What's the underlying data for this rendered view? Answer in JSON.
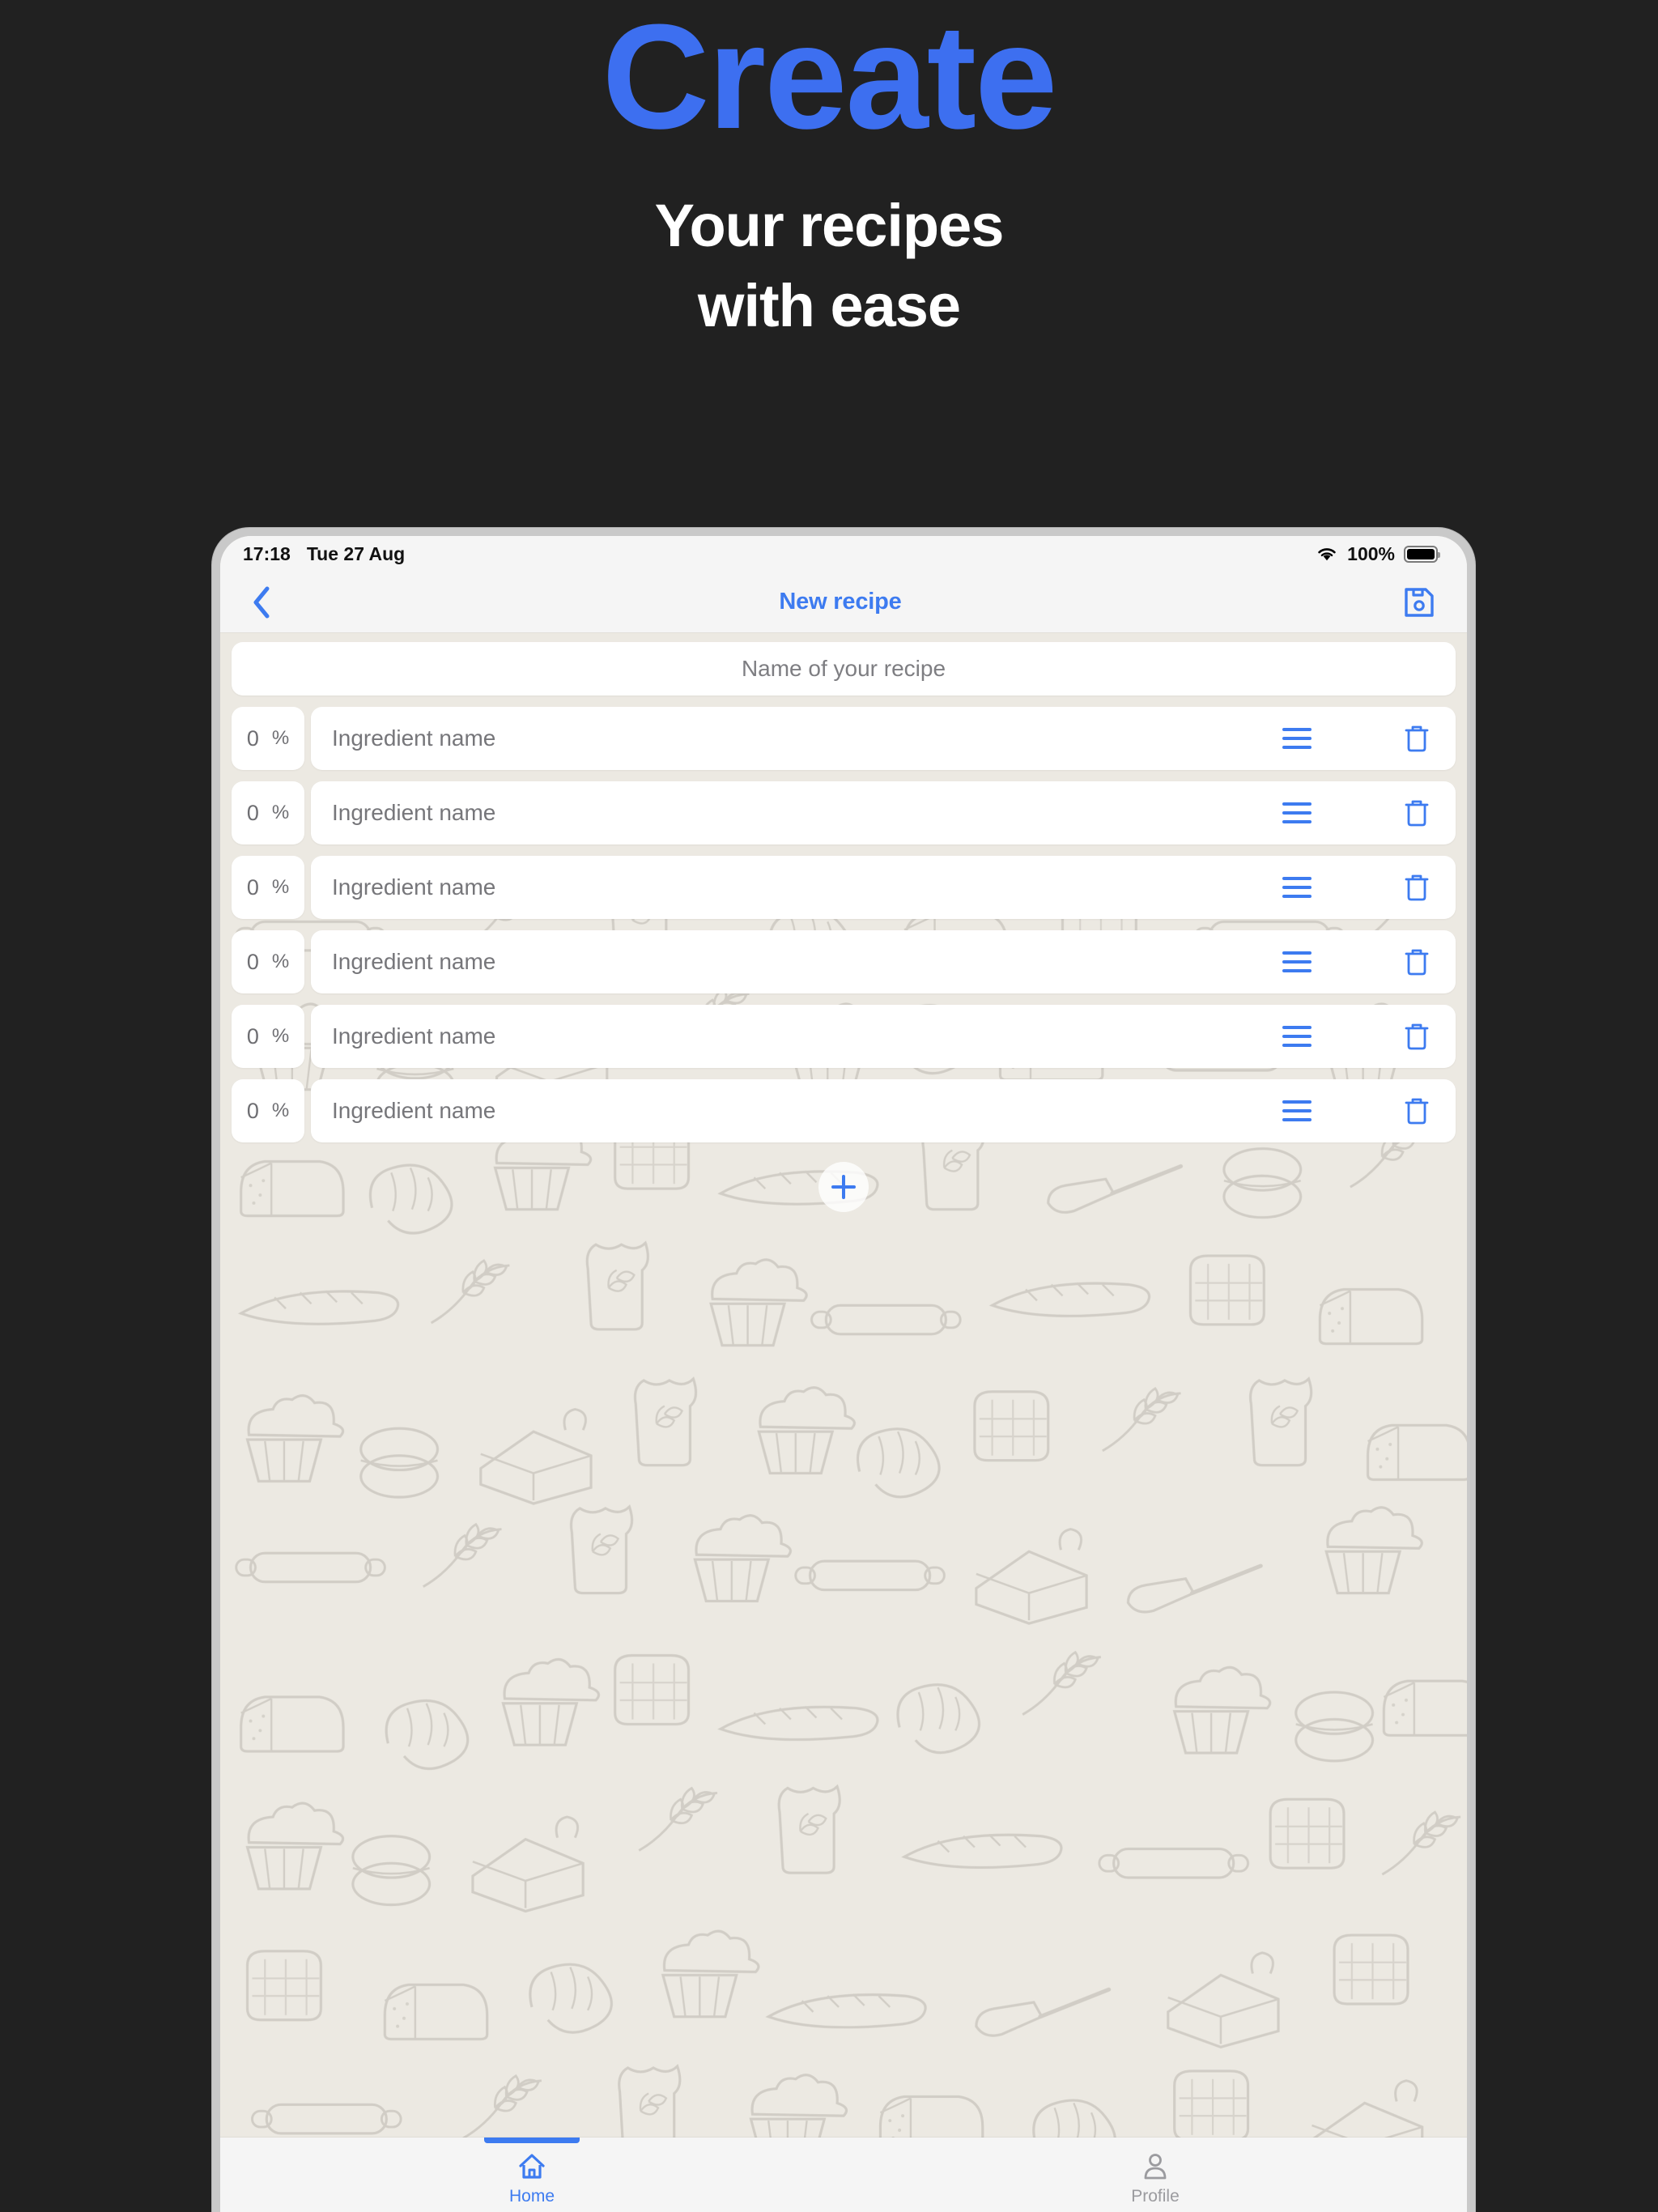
{
  "promo": {
    "title": "Create",
    "subtitle_line1": "Your recipes",
    "subtitle_line2": "with ease",
    "title_color": "#3d6ff0",
    "subtitle_color": "#ffffff",
    "background_color": "#212121"
  },
  "device": {
    "statusbar": {
      "time": "17:18",
      "date": "Tue 27 Aug",
      "wifi_icon": "wifi-icon",
      "battery_percent": "100%",
      "battery_icon": "battery-full-icon"
    },
    "navbar": {
      "back_icon": "chevron-left-icon",
      "title": "New recipe",
      "save_icon": "floppy-disk-save-icon",
      "accent_color": "#3d7bf0"
    },
    "form": {
      "recipe_name_placeholder": "Name of your recipe",
      "recipe_name_value": "",
      "ingredients": [
        {
          "percent_value": "0",
          "percent_unit": "%",
          "name_placeholder": "Ingredient name",
          "name_value": ""
        },
        {
          "percent_value": "0",
          "percent_unit": "%",
          "name_placeholder": "Ingredient name",
          "name_value": ""
        },
        {
          "percent_value": "0",
          "percent_unit": "%",
          "name_placeholder": "Ingredient name",
          "name_value": ""
        },
        {
          "percent_value": "0",
          "percent_unit": "%",
          "name_placeholder": "Ingredient name",
          "name_value": ""
        },
        {
          "percent_value": "0",
          "percent_unit": "%",
          "name_placeholder": "Ingredient name",
          "name_value": ""
        },
        {
          "percent_value": "0",
          "percent_unit": "%",
          "name_placeholder": "Ingredient name",
          "name_value": ""
        }
      ],
      "reorder_icon": "reorder-handle-icon",
      "delete_icon": "trash-icon",
      "add_icon": "plus-icon",
      "background_color": "#ece9e2",
      "field_color": "#ffffff"
    },
    "tabbar": {
      "tabs": [
        {
          "label": "Home",
          "icon": "home-icon",
          "active": true
        },
        {
          "label": "Profile",
          "icon": "person-icon",
          "active": false
        }
      ],
      "active_color": "#3d7bf0",
      "inactive_color": "#9b9b9f"
    }
  }
}
